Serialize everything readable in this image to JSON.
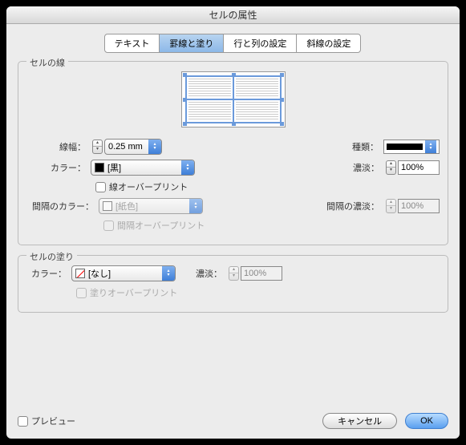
{
  "title": "セルの属性",
  "tabs": [
    "テキスト",
    "罫線と塗り",
    "行と列の設定",
    "斜線の設定"
  ],
  "activeTab": 1,
  "stroke": {
    "legend": "セルの線",
    "weight": {
      "label": "線幅：",
      "value": "0.25 mm"
    },
    "type": {
      "label": "種類："
    },
    "color": {
      "label": "カラー：",
      "value": "[黒]"
    },
    "tint": {
      "label": "濃淡：",
      "value": "100%"
    },
    "overprint": {
      "label": "線オーバープリント"
    },
    "gapColor": {
      "label": "間隔のカラー：",
      "value": "[紙色]"
    },
    "gapTint": {
      "label": "間隔の濃淡：",
      "value": "100%"
    },
    "gapOverprint": {
      "label": "間隔オーバープリント"
    }
  },
  "fill": {
    "legend": "セルの塗り",
    "color": {
      "label": "カラー：",
      "value": "[なし]"
    },
    "tint": {
      "label": "濃淡：",
      "value": "100%"
    },
    "overprint": {
      "label": "塗りオーバープリント"
    }
  },
  "preview": "プレビュー",
  "buttons": {
    "cancel": "キャンセル",
    "ok": "OK"
  }
}
